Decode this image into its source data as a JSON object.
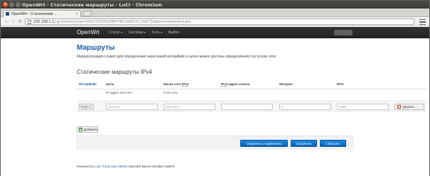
{
  "window": {
    "title": "OpenWrt - Статические маршруты - LuCI - Chromium",
    "buttons": {
      "close": "×",
      "minimize": "–",
      "maximize": "▫"
    }
  },
  "tab": {
    "label": "OpenWrt - Статические ...",
    "close": "×"
  },
  "navbar": {
    "back": "‹",
    "forward": "›",
    "reload": "↻",
    "url_host": "192.168.1.1",
    "url_path": "/cgi-bin/luci/;stok=04c674197616f8474fe1b9427e73d673/admin/network/routes"
  },
  "luci": {
    "brand": "OpenWrt",
    "menu": [
      {
        "label": "Статус",
        "caret": "▾"
      },
      {
        "label": "Система",
        "caret": "▾"
      },
      {
        "label": "Сеть",
        "caret": "▾"
      },
      {
        "label": "Выйти",
        "caret": ""
      }
    ]
  },
  "page": {
    "title": "Маршруты",
    "description": "Маршрутизация служит для определения через какой интерфейс и шлюз можно достичь определённого хоста или сети.",
    "section_title": "Статические маршруты IPv4"
  },
  "table": {
    "headers": {
      "interface": "Интерфейс",
      "target": "Цель",
      "netmask_prefix": "Маска сети ",
      "netmask_abbr": "IPv4",
      "gateway_abbr": "IPv4",
      "gateway_suffix": "-адрес шлюза",
      "metric": "Метрика",
      "mtu": "MTU"
    },
    "subheaders": {
      "target": "IP-адрес или сеть",
      "netmask": "если сеть"
    },
    "row": {
      "interface": "local",
      "interface_caret": "▾",
      "target": "10.0.0.0",
      "netmask": "255.0.0.0",
      "gateway": "",
      "metric": "0",
      "mtu": "1500",
      "delete_label": "Удалить",
      "delete_icon": "×"
    },
    "add_label": "Добавить",
    "add_icon": "+"
  },
  "actions": {
    "save_apply": "Сохранить и применить",
    "save": "Сохранить",
    "reset": "Сбросить"
  },
  "footer": {
    "prefix": "Powered by ",
    "link": "LuCI Trunk (svn-r9844)",
    "suffix": " OpenWrt Barrier Breaker r36979"
  }
}
